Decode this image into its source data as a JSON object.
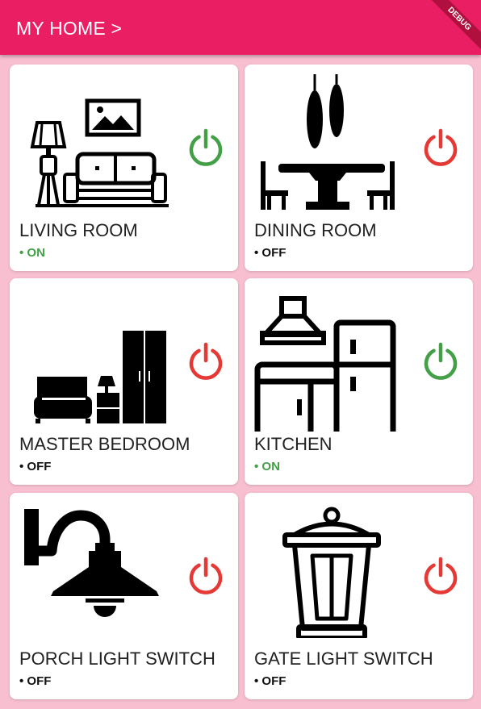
{
  "appbar": {
    "title": "MY HOME >"
  },
  "debug_banner": "DEBUG",
  "colors": {
    "primary": "#e91e63",
    "background": "#f7bfd0",
    "on": "#43a047",
    "off": "#e53935"
  },
  "rooms": [
    {
      "name": "LIVING ROOM",
      "status": "• ON",
      "state": "on",
      "icon": "living-room-icon"
    },
    {
      "name": "DINING ROOM",
      "status": "• OFF",
      "state": "off",
      "icon": "dining-room-icon"
    },
    {
      "name": "MASTER BEDROOM",
      "status": "• OFF",
      "state": "off",
      "icon": "bedroom-icon"
    },
    {
      "name": "KITCHEN",
      "status": "• ON",
      "state": "on",
      "icon": "kitchen-icon"
    },
    {
      "name": "PORCH LIGHT SWITCH",
      "status": "• OFF",
      "state": "off",
      "icon": "porch-light-icon"
    },
    {
      "name": "GATE LIGHT SWITCH",
      "status": "• OFF",
      "state": "off",
      "icon": "gate-light-icon"
    }
  ]
}
